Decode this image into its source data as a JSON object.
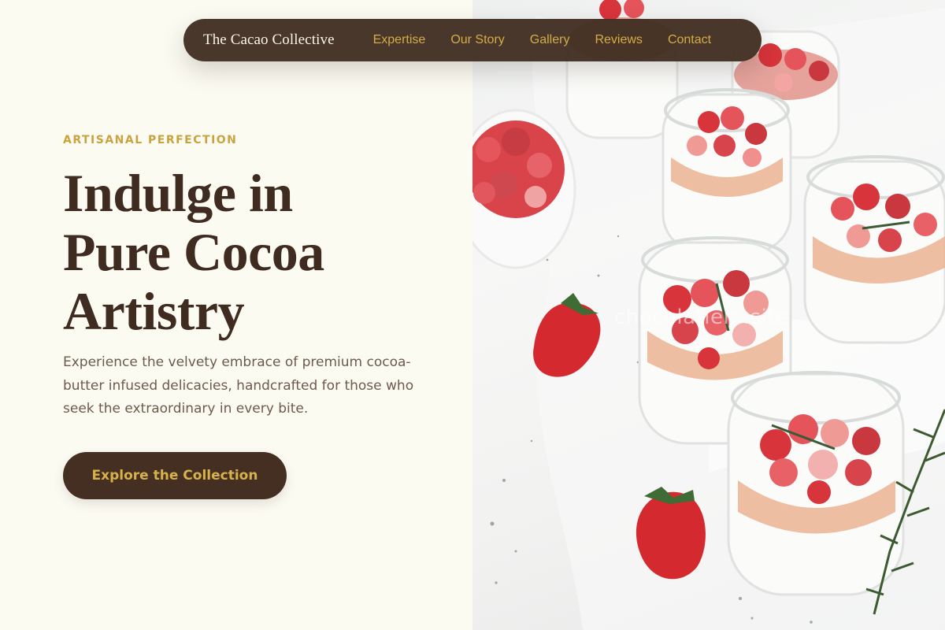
{
  "nav": {
    "brand": "The Cacao Collective",
    "links": [
      "Expertise",
      "Our Story",
      "Gallery",
      "Reviews",
      "Contact"
    ]
  },
  "hero": {
    "eyebrow": "ARTISANAL PERFECTION",
    "headline": [
      "Indulge in",
      "Pure Cocoa",
      "Artistry"
    ],
    "description": "Experience the velvety embrace of premium cocoa-butter infused delicacies, handcrafted for those who seek the extraordinary in every bite.",
    "cta_label": "Explore the Collection"
  },
  "image": {
    "watermark": "chocolatiers.site",
    "subject": "panna-cotta-with-strawberries-photo"
  },
  "colors": {
    "brown": "#452f22",
    "gold": "#d4ad47",
    "cream": "#fcfbf2"
  }
}
